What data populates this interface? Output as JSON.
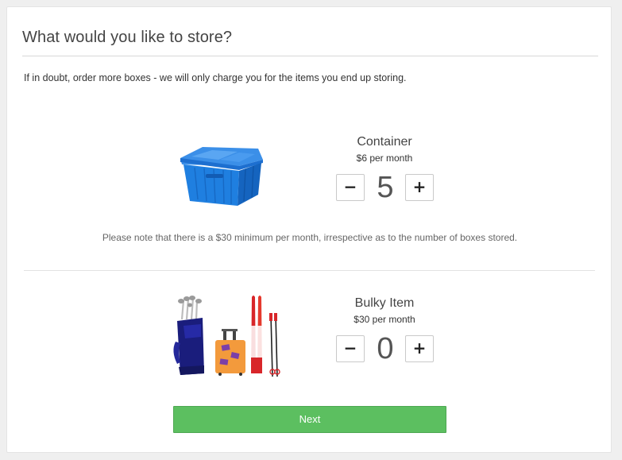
{
  "page": {
    "title": "What would you like to store?",
    "intro": "If in doubt, order more boxes - we will only charge you for the items you end up storing."
  },
  "products": [
    {
      "name": "Container",
      "price": "$6 per month",
      "quantity": "5",
      "icon": "blue-storage-container-icon",
      "minus_label": "−",
      "plus_label": "+"
    },
    {
      "name": "Bulky Item",
      "price": "$30 per month",
      "quantity": "0",
      "icon": "bulky-items-golf-bag-suitcase-skis-icon",
      "minus_label": "−",
      "plus_label": "+"
    }
  ],
  "minimum_note": "Please note that there is a $30 minimum per month, irrespective as to the number of boxes stored.",
  "next_button": "Next",
  "colors": {
    "next_button": "#5cbf60",
    "container_blue": "#1f7fe0",
    "golf_bag_navy": "#1a1d7c",
    "suitcase_orange": "#f39a3c",
    "ski_red": "#d8262a"
  }
}
